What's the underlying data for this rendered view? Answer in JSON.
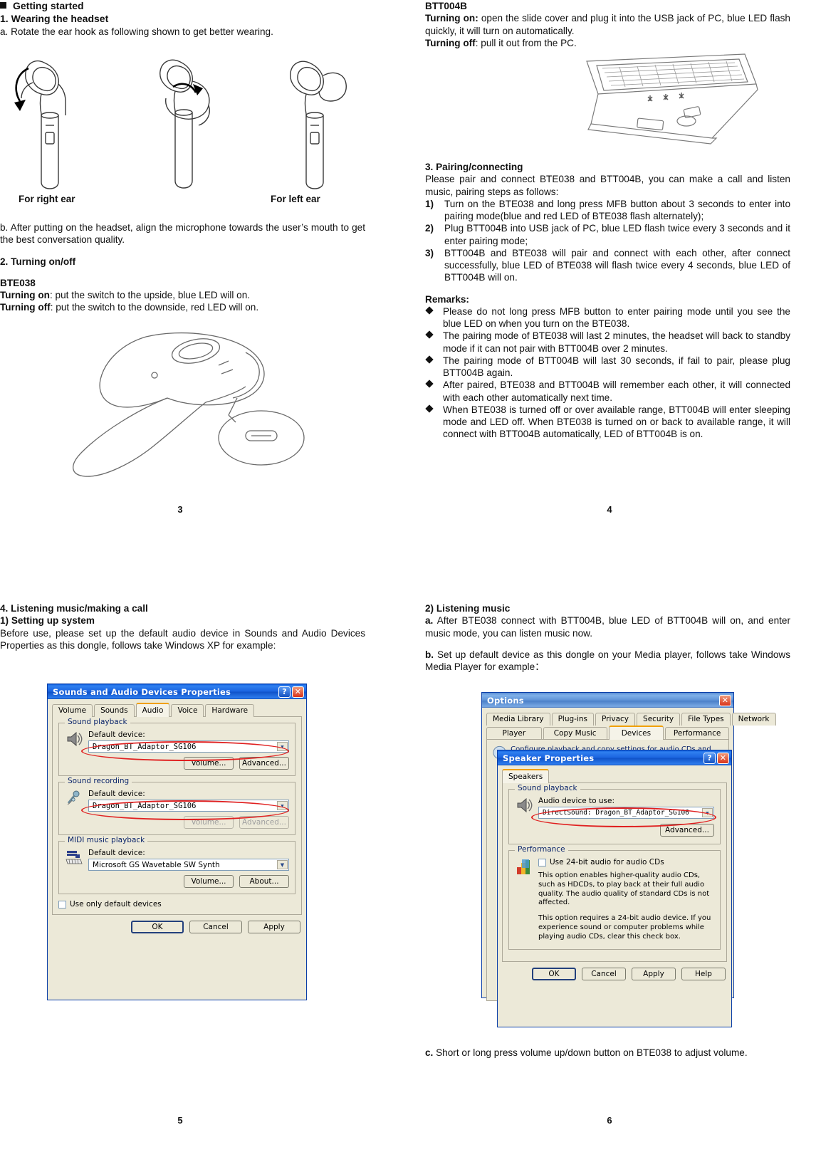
{
  "document": {
    "page_left_top": "3",
    "page_right_top": "4",
    "page_left_bottom": "5",
    "page_right_bottom": "6"
  },
  "page3": {
    "section_heading": "Getting started",
    "h1": "1. Wearing the headset",
    "step_a": "a. Rotate the ear hook as following shown to get better wearing.",
    "label_right_ear": "For right ear",
    "label_left_ear": "For left ear",
    "step_b": "b. After putting on the headset, align the microphone towards the user’s mouth to get the best conversation quality.",
    "h2": "2. Turning on/off",
    "model": "BTE038",
    "turning_on_label": "Turning on",
    "turning_on_text": ": put the switch to the upside, blue LED will on.",
    "turning_off_label": "Turning off",
    "turning_off_text": ": put the switch to the downside, red LED will on."
  },
  "page4": {
    "model": "BTT004B",
    "turning_on_label": "Turning on:",
    "turning_on_text": " open the slide cover and plug it into the USB jack of PC, blue LED flash quickly, it will turn on automatically.",
    "turning_off_label": "Turning off",
    "turning_off_text": ": pull it out from the PC.",
    "h3": "3. Pairing/connecting",
    "intro": "Please pair and connect BTE038 and BTT004B, you can make a call and listen music, pairing steps as follows:",
    "steps": [
      {
        "num": "1)",
        "text": "Turn on the BTE038 and long press MFB button about 3 seconds to enter into pairing mode(blue and red LED of BTE038 flash alternately);"
      },
      {
        "num": "2)",
        "text": "Plug BTT004B into USB jack of PC, blue LED flash twice every 3 seconds and it enter pairing mode;"
      },
      {
        "num": "3)",
        "text": "BTT004B and BTE038 will pair and connect with each other, after connect successfully, blue LED of BTE038 will flash twice every 4 seconds, blue LED of BTT004B will on."
      }
    ],
    "remarks_heading": "Remarks:",
    "remarks": [
      "Please do not long press MFB button to enter pairing mode until you see the blue LED on when you turn on the BTE038.",
      "The pairing mode of BTE038 will last 2 minutes, the headset will back to standby mode if it can not pair with BTT004B over 2 minutes.",
      "The pairing mode of BTT004B will last 30 seconds, if fail to pair, please plug BTT004B again.",
      "After paired, BTE038 and BTT004B will remember each other, it will connected with each other automatically next time.",
      "When BTE038 is turned off or over available range, BTT004B will enter sleeping mode and LED off. When BTE038 is turned on or back to available range, it will connect with BTT004B automatically, LED of BTT004B is on."
    ]
  },
  "page5": {
    "h4": "4. Listening music/making a call",
    "h4_1": "1) Setting up system",
    "intro": "Before use, please set up the default audio device in Sounds and Audio Devices Properties as this dongle, follows take Windows XP for example:",
    "dialog": {
      "title": "Sounds and Audio Devices Properties",
      "help_button": "?",
      "close_button": "✕",
      "tabs": [
        {
          "label": "Volume",
          "active": false
        },
        {
          "label": "Sounds",
          "active": false
        },
        {
          "label": "Audio",
          "active": true
        },
        {
          "label": "Voice",
          "active": false
        },
        {
          "label": "Hardware",
          "active": false
        }
      ],
      "groups": [
        {
          "label": "Sound playback",
          "icon": "speaker-icon",
          "field_label": "Default device:",
          "value": "Dragon_BT_Adaptor_SG106",
          "highlighted": true,
          "buttons": [
            {
              "label": "Volume...",
              "disabled": false
            },
            {
              "label": "Advanced...",
              "disabled": false
            }
          ]
        },
        {
          "label": "Sound recording",
          "icon": "microphone-icon",
          "field_label": "Default device:",
          "value": "Dragon_BT_Adaptor_SG106",
          "highlighted": true,
          "buttons": [
            {
              "label": "Volume...",
              "disabled": true
            },
            {
              "label": "Advanced...",
              "disabled": true
            }
          ]
        },
        {
          "label": "MIDI music playback",
          "icon": "midi-keyboard-icon",
          "field_label": "Default device:",
          "value": "Microsoft GS Wavetable SW Synth",
          "highlighted": false,
          "buttons": [
            {
              "label": "Volume...",
              "disabled": false
            },
            {
              "label": "About...",
              "disabled": false
            }
          ]
        }
      ],
      "checkbox_label": "Use only default devices",
      "checkbox_checked": false,
      "footer_buttons": [
        {
          "label": "OK",
          "default": true
        },
        {
          "label": "Cancel",
          "default": false
        },
        {
          "label": "Apply",
          "default": false
        }
      ]
    }
  },
  "page6": {
    "h2": "2) Listening music",
    "a_label": "a.",
    "a_text": " After BTE038 connect with BTT004B, blue LED of BTT004B will on, and enter music mode, you can listen music now.",
    "b_label": "b.",
    "b_text": " Set up default device as this dongle on your Media player, follows take Windows Media Player for example：",
    "c_label": "c.",
    "c_text": " Short or long press volume up/down button on BTE038 to adjust volume.",
    "options_dialog": {
      "title": "Options",
      "close_button": "✕",
      "tabs_row1": [
        {
          "label": "Media Library",
          "active": false
        },
        {
          "label": "Plug-ins",
          "active": false
        },
        {
          "label": "Privacy",
          "active": false
        },
        {
          "label": "Security",
          "active": false
        },
        {
          "label": "File Types",
          "active": false
        },
        {
          "label": "Network",
          "active": false
        }
      ],
      "tabs_row2": [
        {
          "label": "Player",
          "active": false
        },
        {
          "label": "Copy Music",
          "active": false
        },
        {
          "label": "Devices",
          "active": true
        },
        {
          "label": "Performance",
          "active": false
        }
      ],
      "description": "Configure playback and copy settings for audio CDs and oth..."
    },
    "speaker_dialog": {
      "title": "Speaker Properties",
      "help_button": "?",
      "close_button": "✕",
      "tabs": [
        {
          "label": "Speakers",
          "active": true
        }
      ],
      "playback_group_label": "Sound playback",
      "playback_field_label": "Audio device to use:",
      "playback_value": "DirectSound: Dragon_BT_Adaptor_SG106",
      "advanced_button": "Advanced...",
      "performance_group_label": "Performance",
      "performance_checkbox_label": "Use 24-bit audio for audio CDs",
      "performance_checkbox_checked": false,
      "performance_text_1": "This option enables higher-quality audio CDs, such as HDCDs, to play back at their full audio quality. The audio quality of standard CDs is not affected.",
      "performance_text_2": "This option requires a 24-bit audio device. If you experience sound or computer problems while playing audio CDs, clear this check box.",
      "footer_buttons": [
        {
          "label": "OK",
          "default": true
        },
        {
          "label": "Cancel",
          "default": false
        },
        {
          "label": "Apply",
          "default": false
        },
        {
          "label": "Help",
          "default": false
        }
      ]
    }
  },
  "colors": {
    "highlight_red": "#e02020",
    "title_blue": "#0a56d6",
    "group_label_blue": "#0a246a"
  }
}
